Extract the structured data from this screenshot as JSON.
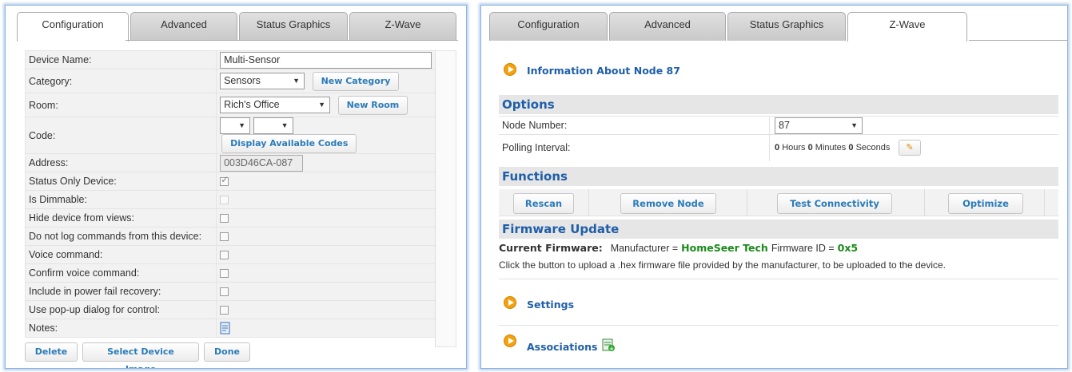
{
  "left": {
    "tabs": [
      "Configuration",
      "Advanced",
      "Status Graphics",
      "Z-Wave"
    ],
    "active_tab": "Configuration",
    "fields": {
      "device_name_label": "Device Name:",
      "device_name_value": "Multi-Sensor",
      "category_label": "Category:",
      "category_value": "Sensors",
      "new_category": "New Category",
      "room_label": "Room:",
      "room_value": "Rich's Office",
      "new_room": "New Room",
      "code_label": "Code:",
      "display_codes": "Display Available Codes",
      "address_label": "Address:",
      "address_value": "003D46CA-087",
      "status_only_label": "Status Only Device:",
      "is_dimmable_label": "Is Dimmable:",
      "hide_views_label": "Hide device from views:",
      "no_log_label": "Do not log commands from this device:",
      "voice_command_label": "Voice command:",
      "confirm_voice_label": "Confirm voice command:",
      "power_fail_label": "Include in power fail recovery:",
      "popup_label": "Use pop-up dialog for control:",
      "notes_label": "Notes:"
    },
    "checkboxes": {
      "status_only": true,
      "is_dimmable": false,
      "hide_views": false,
      "no_log": false,
      "voice_command": false,
      "confirm_voice": false,
      "power_fail": false,
      "popup": false
    },
    "footer": {
      "delete": "Delete",
      "select_image": "Select Device Image",
      "done": "Done"
    }
  },
  "right": {
    "tabs": [
      "Configuration",
      "Advanced",
      "Status Graphics",
      "Z-Wave"
    ],
    "active_tab": "Z-Wave",
    "info_title": "Information About Node 87",
    "options_title": "Options",
    "node_number_label": "Node Number:",
    "node_number_value": "87",
    "polling_label": "Polling Interval:",
    "polling": {
      "hours": "0",
      "hours_label": "Hours",
      "minutes": "0",
      "minutes_label": "Minutes",
      "seconds": "0",
      "seconds_label": "Seconds"
    },
    "functions_title": "Functions",
    "functions": {
      "rescan": "Rescan",
      "remove_node": "Remove Node",
      "test_connectivity": "Test Connectivity",
      "optimize": "Optimize"
    },
    "firmware_title": "Firmware Update",
    "firmware": {
      "current_label": "Current Firmware:",
      "manufacturer_prefix": "Manufacturer =",
      "manufacturer": "HomeSeer Tech",
      "id_prefix": "Firmware ID =",
      "id": "0x5",
      "upload_text": "Click the button to upload a .hex firmware file provided by the manufacturer, to be uploaded to the device."
    },
    "settings_title": "Settings",
    "associations_title": "Associations"
  },
  "colors": {
    "accent_blue": "#1f5ea8",
    "button_text": "#2b7bb9",
    "orange": "#f3a10d",
    "firmware_green": "#1a8a1a",
    "panel_glow": "#b8d2f0"
  }
}
